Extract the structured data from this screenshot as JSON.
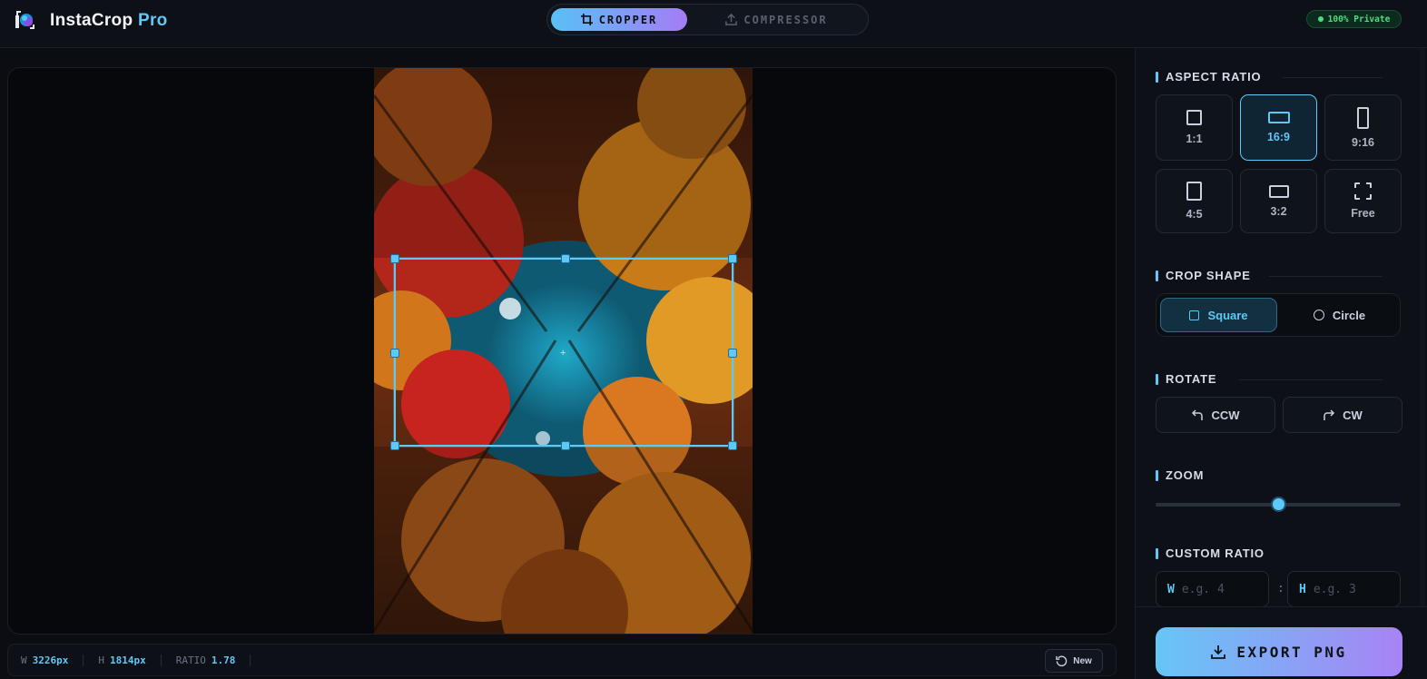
{
  "app": {
    "name": "InstaCrop",
    "name_suffix": "Pro",
    "privacy_badge": "100% Private"
  },
  "modes": {
    "cropper": "CROPPER",
    "compressor": "COMPRESSOR",
    "active": "cropper"
  },
  "status": {
    "w_key": "W",
    "w_value": "3226px",
    "h_key": "H",
    "h_value": "1814px",
    "ratio_key": "RATIO",
    "ratio_value": "1.78",
    "new_label": "New"
  },
  "panel": {
    "aspect_ratio": {
      "title": "ASPECT RATIO",
      "options": [
        "1:1",
        "16:9",
        "9:16",
        "4:5",
        "3:2",
        "Free"
      ],
      "selected": "16:9"
    },
    "crop_shape": {
      "title": "CROP SHAPE",
      "square": "Square",
      "circle": "Circle",
      "selected": "Square"
    },
    "rotate": {
      "title": "ROTATE",
      "ccw": "CCW",
      "cw": "CW"
    },
    "zoom": {
      "title": "ZOOM",
      "value_fraction": 0.5
    },
    "custom_ratio": {
      "title": "CUSTOM RATIO",
      "w_label": "W",
      "w_placeholder": "e.g. 4",
      "h_label": "H",
      "h_placeholder": "e.g. 3",
      "separator": ":"
    },
    "export_label": "EXPORT PNG"
  },
  "colors": {
    "accent": "#5ec8f7",
    "accent2": "#a47cf6",
    "privacy_green": "#4ade80"
  }
}
